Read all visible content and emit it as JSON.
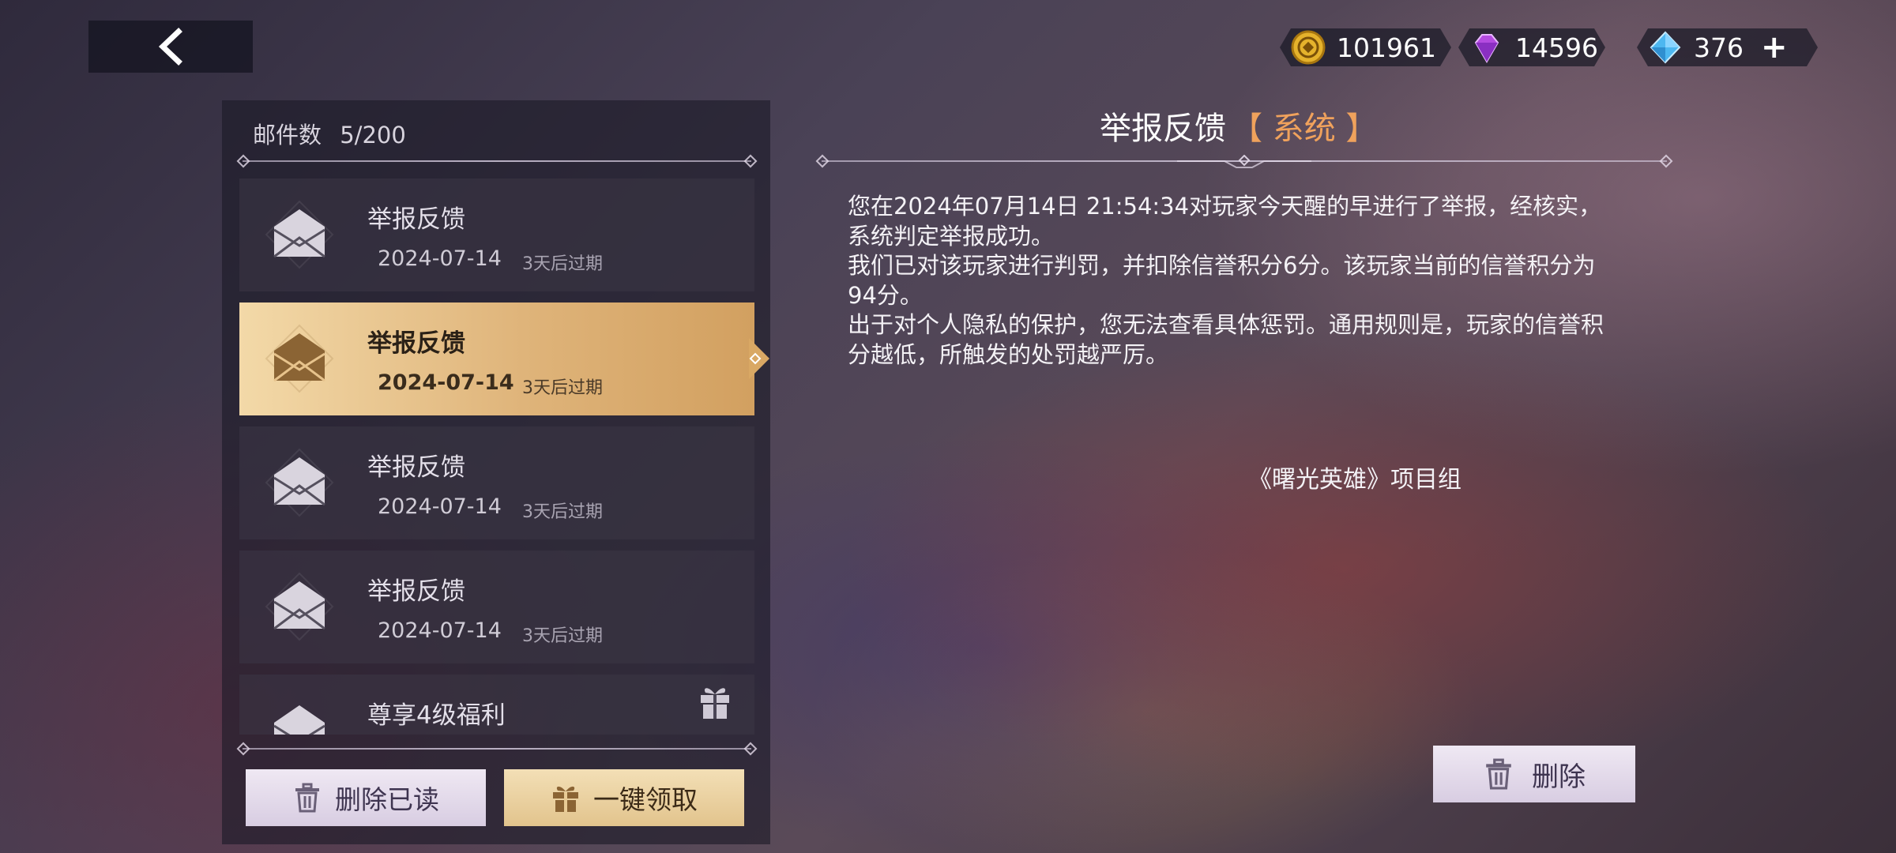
{
  "currencies": [
    {
      "name": "gold-coin",
      "value": "101961"
    },
    {
      "name": "purple-gem",
      "value": "14596"
    },
    {
      "name": "blue-crystal",
      "value": "376"
    }
  ],
  "currency_add_label": "+",
  "mail_list": {
    "count_label": "邮件数",
    "count_value": "5/200",
    "items": [
      {
        "title": "举报反馈",
        "date": "2024-07-14",
        "expire": "3天后过期",
        "selected": false
      },
      {
        "title": "举报反馈",
        "date": "2024-07-14",
        "expire": "3天后过期",
        "selected": true
      },
      {
        "title": "举报反馈",
        "date": "2024-07-14",
        "expire": "3天后过期",
        "selected": false
      },
      {
        "title": "举报反馈",
        "date": "2024-07-14",
        "expire": "3天后过期",
        "selected": false
      },
      {
        "title": "尊享4级福利",
        "selected": false,
        "has_gift": true
      }
    ],
    "delete_read_label": "删除已读",
    "claim_all_label": "一键领取"
  },
  "detail": {
    "title": "举报反馈",
    "tag": "【 系统 】",
    "body_lines": [
      "您在2024年07月14日 21:54:34对玩家今天醒的早进行了举报，经核实，",
      "系统判定举报成功。",
      "我们已对该玩家进行判罚，并扣除信誉积分6分。该玩家当前的信誉积分为",
      "94分。",
      "出于对个人隐私的保护，您无法查看具体惩罚。通用规则是，玩家的信誉积",
      "分越低，所触发的处罚越严厉。"
    ],
    "signature": "《曙光英雄》项目组",
    "delete_label": "删除"
  },
  "colors": {
    "selected_item": "#dfb47a",
    "tag_orange": "#f0a25c",
    "button_light": "#e6ddeb",
    "button_gold": "#ebd3a2"
  }
}
